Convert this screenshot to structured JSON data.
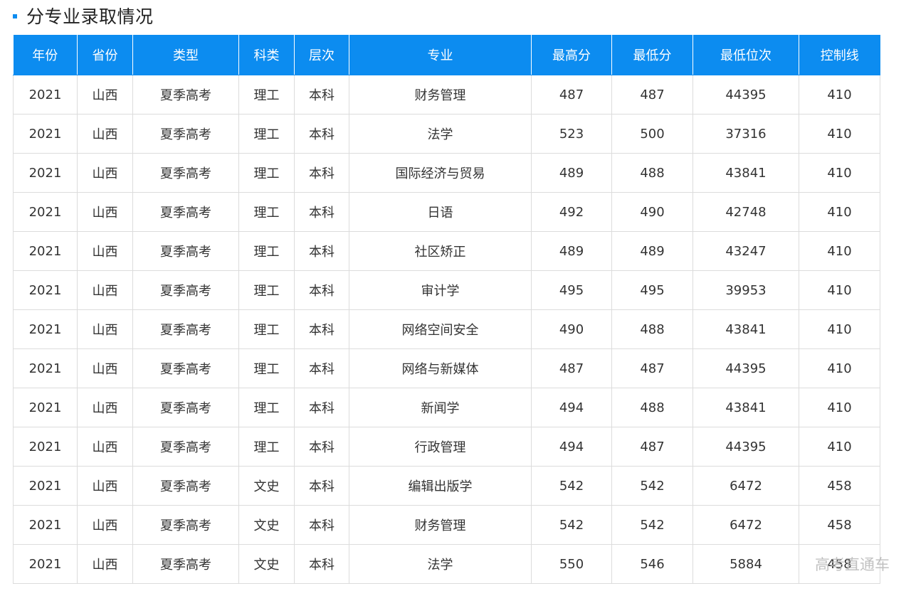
{
  "section": {
    "title": "分专业录取情况"
  },
  "table": {
    "headers": [
      "年份",
      "省份",
      "类型",
      "科类",
      "层次",
      "专业",
      "最高分",
      "最低分",
      "最低位次",
      "控制线"
    ],
    "rows": [
      [
        "2021",
        "山西",
        "夏季高考",
        "理工",
        "本科",
        "财务管理",
        "487",
        "487",
        "44395",
        "410"
      ],
      [
        "2021",
        "山西",
        "夏季高考",
        "理工",
        "本科",
        "法学",
        "523",
        "500",
        "37316",
        "410"
      ],
      [
        "2021",
        "山西",
        "夏季高考",
        "理工",
        "本科",
        "国际经济与贸易",
        "489",
        "488",
        "43841",
        "410"
      ],
      [
        "2021",
        "山西",
        "夏季高考",
        "理工",
        "本科",
        "日语",
        "492",
        "490",
        "42748",
        "410"
      ],
      [
        "2021",
        "山西",
        "夏季高考",
        "理工",
        "本科",
        "社区矫正",
        "489",
        "489",
        "43247",
        "410"
      ],
      [
        "2021",
        "山西",
        "夏季高考",
        "理工",
        "本科",
        "审计学",
        "495",
        "495",
        "39953",
        "410"
      ],
      [
        "2021",
        "山西",
        "夏季高考",
        "理工",
        "本科",
        "网络空间安全",
        "490",
        "488",
        "43841",
        "410"
      ],
      [
        "2021",
        "山西",
        "夏季高考",
        "理工",
        "本科",
        "网络与新媒体",
        "487",
        "487",
        "44395",
        "410"
      ],
      [
        "2021",
        "山西",
        "夏季高考",
        "理工",
        "本科",
        "新闻学",
        "494",
        "488",
        "43841",
        "410"
      ],
      [
        "2021",
        "山西",
        "夏季高考",
        "理工",
        "本科",
        "行政管理",
        "494",
        "487",
        "44395",
        "410"
      ],
      [
        "2021",
        "山西",
        "夏季高考",
        "文史",
        "本科",
        "编辑出版学",
        "542",
        "542",
        "6472",
        "458"
      ],
      [
        "2021",
        "山西",
        "夏季高考",
        "文史",
        "本科",
        "财务管理",
        "542",
        "542",
        "6472",
        "458"
      ],
      [
        "2021",
        "山西",
        "夏季高考",
        "文史",
        "本科",
        "法学",
        "550",
        "546",
        "5884",
        "458"
      ]
    ]
  },
  "watermark": {
    "text": "高考直通车"
  },
  "colors": {
    "accent": "#0c8cf0",
    "header_text": "#ffffff",
    "border": "#dcdcdc"
  }
}
